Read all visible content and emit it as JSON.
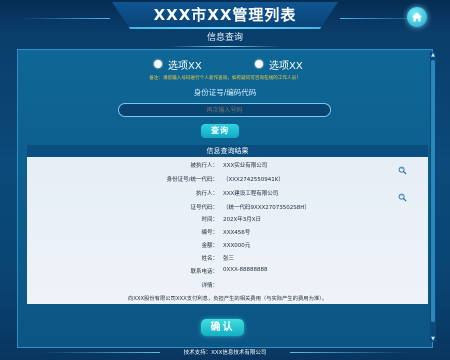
{
  "header": {
    "title": "XXX市XX管理列表"
  },
  "panel": {
    "title": "信息查询"
  },
  "options": [
    {
      "label": "选项XX",
      "selected": true
    },
    {
      "label": "选项XX",
      "selected": false
    }
  ],
  "note": "备注：请您输入号码进行个人爱作查询，如有疑问可咨询在线的工作人员！",
  "id_field": {
    "label": "身份证号/编码代码",
    "placeholder": "再次输入号码"
  },
  "query_button": "查询",
  "results": {
    "title": "信息查询结果",
    "rows": [
      {
        "label": "被执行人：",
        "value": "XXX实业有限公司"
      },
      {
        "label": "身份证号/统一代码：",
        "value": "（XXX2742550941K）"
      },
      {
        "label": "执行人：",
        "value": "XXX建设工程有限公司"
      },
      {
        "label": "证号代码：",
        "value": "（统一代码9XXX27073502S8H）"
      },
      {
        "label": "时间：",
        "value": "202X年3月X日"
      },
      {
        "label": "编号：",
        "value": "XXX456号"
      },
      {
        "label": "金额：",
        "value": "XXX000元"
      },
      {
        "label": "姓名：",
        "value": "张三"
      },
      {
        "label": "联系电话：",
        "value": "0XXX-88888888"
      },
      {
        "label": "详情：",
        "value": ""
      }
    ],
    "detail": "向XXX股份有限公司XXX支付利息，负担产生的相关费用（与实际产生的费用为准）。"
  },
  "confirm_button": "确认",
  "footer": "技术支持：XXX信息技术有限公司",
  "icons": {
    "home": "home-icon",
    "search": "magnifier-icon"
  },
  "colors": {
    "accent": "#1fb8cc",
    "note": "#f5cd3d",
    "background": "#0b4a7a"
  }
}
